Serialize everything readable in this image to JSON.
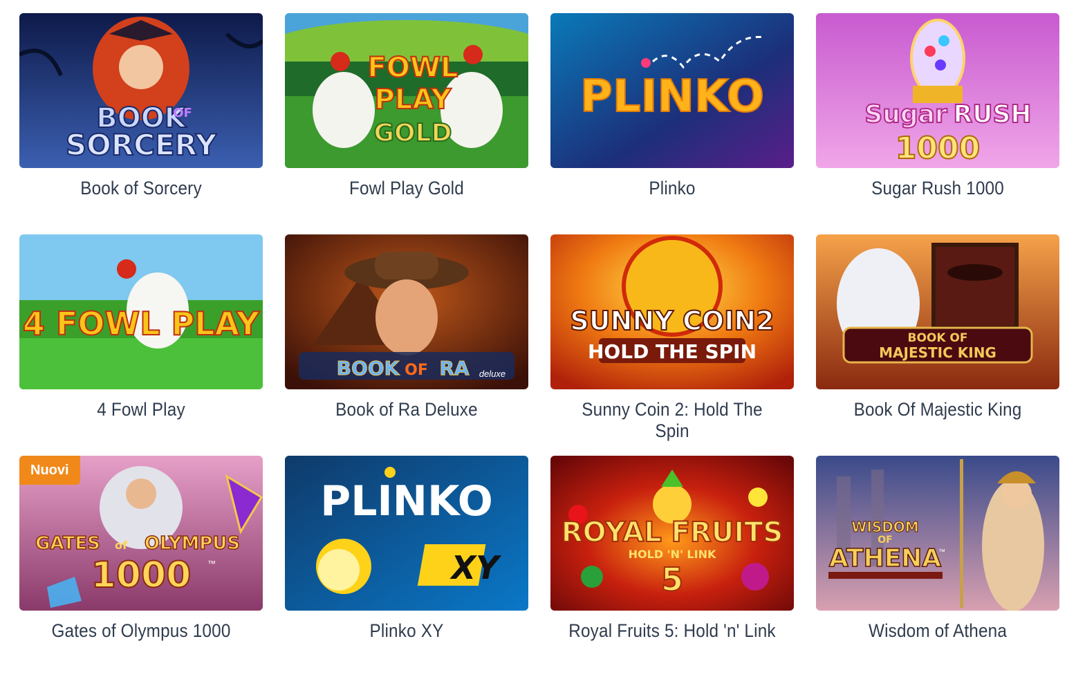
{
  "games": [
    {
      "title": "Book of Sorcery"
    },
    {
      "title": "Fowl Play Gold"
    },
    {
      "title": "Plinko"
    },
    {
      "title": "Sugar Rush 1000"
    },
    {
      "title": "4 Fowl Play"
    },
    {
      "title": "Book of Ra Deluxe"
    },
    {
      "title": "Sunny Coin 2: Hold The Spin"
    },
    {
      "title": "Book Of Majestic King"
    },
    {
      "title": "Gates of Olympus 1000",
      "badge": "Nuovi"
    },
    {
      "title": "Plinko XY"
    },
    {
      "title": "Royal Fruits 5: Hold 'n' Link"
    },
    {
      "title": "Wisdom of Athena"
    }
  ],
  "logos": {
    "book_of_sorcery": [
      "BOOK",
      "OF",
      "SORCERY"
    ],
    "fowl_play_gold": [
      "FOWL",
      "PLAY",
      "GOLD"
    ],
    "plinko": "PLINKO",
    "sugar_rush": [
      "Sugar",
      "RUSH",
      "1000"
    ],
    "four_fowl_play": "4 FOWL PLAY",
    "book_of_ra": [
      "BOOK",
      "OF",
      "RA",
      "deluxe"
    ],
    "sunny_coin": [
      "SUNNY COIN2",
      "HOLD THE SPIN"
    ],
    "majestic_king": [
      "BOOK OF",
      "MAJESTIC KING"
    ],
    "gates_olympus": [
      "GATES",
      "of",
      "OLYMPUS",
      "1000",
      "™"
    ],
    "plinko_xy": [
      "PLINKO",
      "XY"
    ],
    "royal_fruits": [
      "ROYAL FRUITS",
      "HOLD 'N' LINK",
      "5"
    ],
    "wisdom_athena": [
      "WISDOM",
      "OF",
      "ATHENA",
      "™"
    ]
  }
}
